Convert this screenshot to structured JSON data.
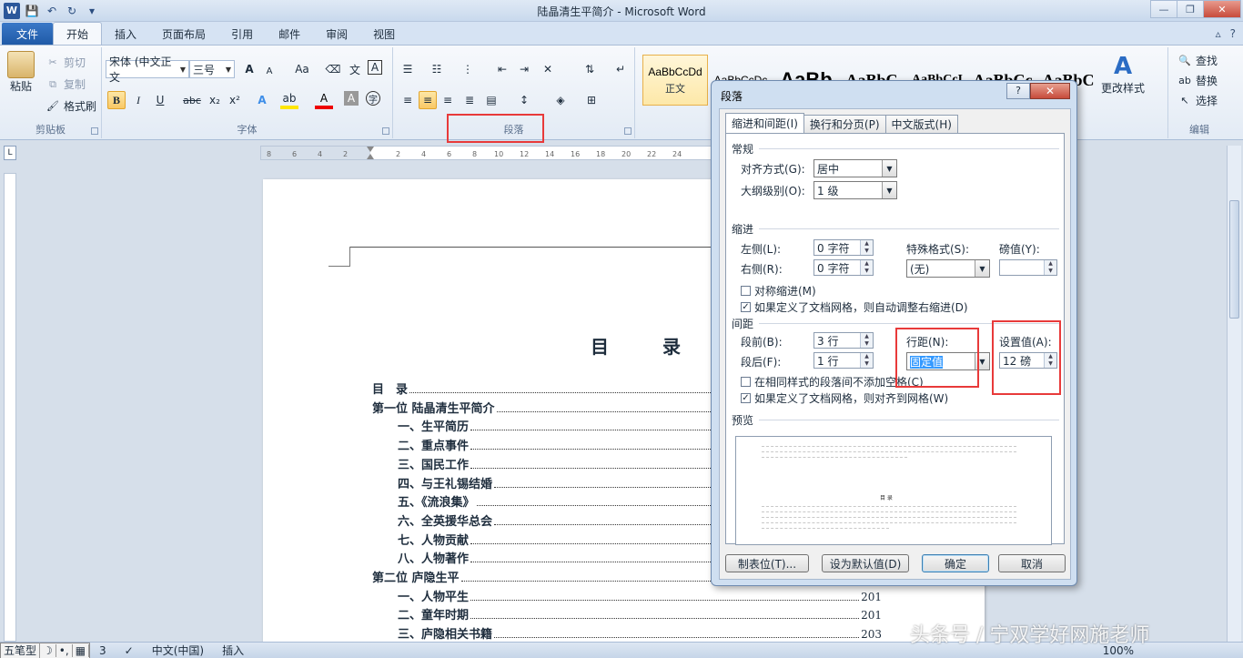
{
  "window": {
    "title": "陆晶清生平简介 - Microsoft Word",
    "controls": {
      "minimize": "—",
      "restore": "❐",
      "close": "✕"
    }
  },
  "qat": {
    "app_icon": "W",
    "save": "💾",
    "undo": "↶",
    "redo": "↻",
    "customize": "▾"
  },
  "ribbon_tabs": [
    "文件",
    "开始",
    "插入",
    "页面布局",
    "引用",
    "邮件",
    "审阅",
    "视图"
  ],
  "clipboard": {
    "label": "剪贴板",
    "paste": "粘贴",
    "cut": "剪切",
    "copy": "复制",
    "format_painter": "格式刷"
  },
  "font": {
    "label": "字体",
    "name": "宋体 (中文正文",
    "size": "三号",
    "grow": "A",
    "shrink": "A",
    "change_case": "Aa",
    "bold": "B",
    "italic": "I",
    "underline": "U",
    "strike": "abc",
    "subscript": "x₂",
    "superscript": "x²",
    "font_color": "A"
  },
  "paragraph": {
    "label": "段落"
  },
  "styles": {
    "items": [
      {
        "sample": "AaBbCcDd",
        "name": "正文"
      },
      {
        "sample": "AaBbCcDc",
        "name": ""
      },
      {
        "sample": "AaBb",
        "name": ""
      },
      {
        "sample": "AaBbC",
        "name": ""
      },
      {
        "sample": "AaBbCcI",
        "name": ""
      },
      {
        "sample": "AaBbCc",
        "name": ""
      },
      {
        "sample": "AaBbC",
        "name": ""
      }
    ],
    "change": "更改样式"
  },
  "editing": {
    "label": "编辑",
    "find": "查找",
    "replace": "替换",
    "select": "选择"
  },
  "document": {
    "title": "目 录",
    "toc": [
      {
        "text": "目　录",
        "page": "",
        "level": 1
      },
      {
        "text": "第一位 陆晶清生平简介",
        "page": "",
        "level": 1
      },
      {
        "text": "一、生平简历",
        "page": "",
        "level": 2
      },
      {
        "text": "二、重点事件",
        "page": "",
        "level": 2
      },
      {
        "text": "三、国民工作",
        "page": "",
        "level": 2
      },
      {
        "text": "四、与王礼锡结婚",
        "page": "",
        "level": 2
      },
      {
        "text": "五、《流浪集》",
        "page": "",
        "level": 2
      },
      {
        "text": "六、全英援华总会",
        "page": "",
        "level": 2
      },
      {
        "text": "七、人物贡献",
        "page": "",
        "level": 2
      },
      {
        "text": "八、人物著作",
        "page": "",
        "level": 2
      },
      {
        "text": "第二位 庐隐生平",
        "page": "",
        "level": 1
      },
      {
        "text": "一、人物平生",
        "page": "201",
        "level": 2
      },
      {
        "text": "二、童年时期",
        "page": "201",
        "level": 2
      },
      {
        "text": "三、庐隐相关书籍",
        "page": "203",
        "level": 2
      }
    ]
  },
  "dialog": {
    "title": "段落",
    "help": "?",
    "close": "✕",
    "tabs": [
      "缩进和间距(I)",
      "换行和分页(P)",
      "中文版式(H)"
    ],
    "general": {
      "label": "常规",
      "alignment_label": "对齐方式(G):",
      "alignment_value": "居中",
      "outline_label": "大纲级别(O):",
      "outline_value": "1 级"
    },
    "indent": {
      "label": "缩进",
      "left_label": "左侧(L):",
      "left_value": "0 字符",
      "right_label": "右侧(R):",
      "right_value": "0 字符",
      "special_label": "特殊格式(S):",
      "special_value": "(无)",
      "by_label": "磅值(Y):",
      "by_value": "",
      "mirror": "对称缩进(M)",
      "auto_adjust": "如果定义了文档网格，则自动调整右缩进(D)"
    },
    "spacing": {
      "label": "间距",
      "before_label": "段前(B):",
      "before_value": "3 行",
      "after_label": "段后(F):",
      "after_value": "1 行",
      "line_label": "行距(N):",
      "line_value": "固定值",
      "at_label": "设置值(A):",
      "at_value": "12 磅",
      "no_space": "在相同样式的段落间不添加空格(C)",
      "snap_grid": "如果定义了文档网格，则对齐到网格(W)"
    },
    "preview_label": "预览",
    "preview_center": "目 录",
    "buttons": {
      "tabs": "制表位(T)...",
      "default": "设为默认值(D)",
      "ok": "确定",
      "cancel": "取消"
    }
  },
  "status": {
    "ime_mode": "五笔型",
    "ime_moon": "☽",
    "ime_punct": "•,",
    "ime_kbd": "▦",
    "page_info": "3",
    "lang": "中文(中国)",
    "mode": "插入",
    "zoom": "100%"
  },
  "watermark": "头条号 / 宁双学好网施老师"
}
